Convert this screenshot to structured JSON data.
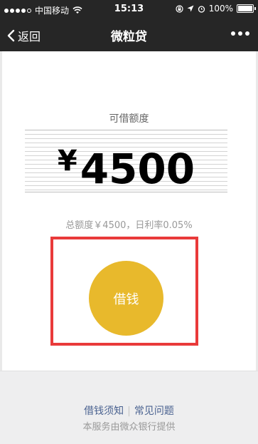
{
  "status_bar": {
    "carrier": "中国移动",
    "time": "15:13",
    "battery": "100%"
  },
  "nav": {
    "back_label": "返回",
    "title": "微粒贷"
  },
  "credit": {
    "label": "可借额度",
    "currency": "¥",
    "amount": "4500",
    "summary": "总额度￥4500，日利率0.05%"
  },
  "borrow_button": {
    "label": "借钱"
  },
  "footer": {
    "link_borrow_notice": "借钱须知",
    "link_faq": "常见问题",
    "note": "本服务由微众银行提供"
  },
  "colors": {
    "nav_background": "#262626",
    "button": "#e8b92c",
    "highlight": "#e93a3a",
    "link": "#4a6290"
  }
}
